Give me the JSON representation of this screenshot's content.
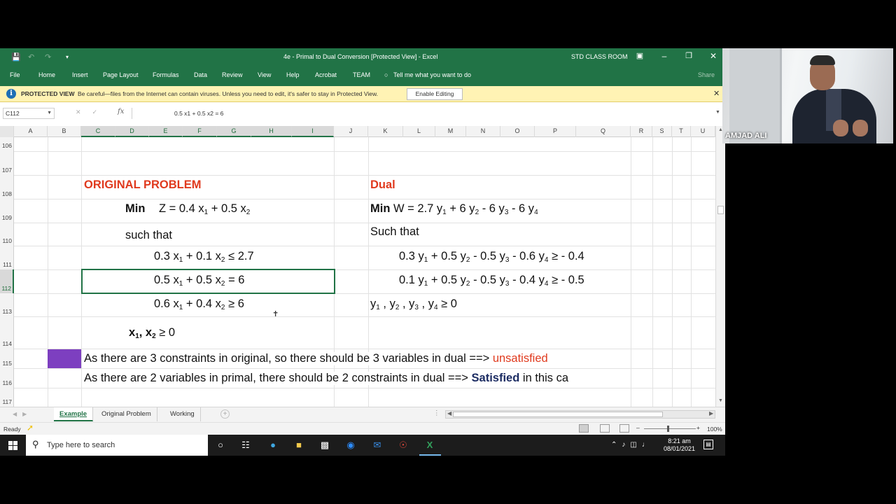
{
  "window": {
    "title": "4e - Primal to Dual Conversion  [Protected View]  -  Excel",
    "account": "STD CLASS ROOM",
    "quick_access": [
      "save-icon",
      "undo-icon",
      "redo-icon",
      "customize-icon"
    ],
    "window_buttons": [
      "ribbon-display-icon",
      "minimize-icon",
      "restore-icon",
      "close-icon"
    ]
  },
  "ribbon": {
    "tabs": [
      "File",
      "Home",
      "Insert",
      "Page Layout",
      "Formulas",
      "Data",
      "Review",
      "View",
      "Help",
      "Acrobat",
      "TEAM"
    ],
    "tell_me": "Tell me what you want to do",
    "share": "Share"
  },
  "protected_view": {
    "title": "PROTECTED VIEW",
    "message": "Be careful—files from the Internet can contain viruses. Unless you need to edit, it's safer to stay in Protected View.",
    "button": "Enable Editing"
  },
  "formula_bar": {
    "name_box": "C112",
    "formula": "0.5 x1 + 0.5 x2 = 6"
  },
  "columns": [
    "A",
    "B",
    "C",
    "D",
    "E",
    "F",
    "G",
    "H",
    "I",
    "J",
    "K",
    "L",
    "M",
    "N",
    "O",
    "P",
    "Q",
    "R",
    "S",
    "T",
    "U"
  ],
  "rows": [
    "106",
    "107",
    "108",
    "109",
    "110",
    "111",
    "112",
    "113",
    "114",
    "115",
    "116",
    "117"
  ],
  "selected_cell": {
    "column": "C",
    "row": "112"
  },
  "sheet": {
    "original_heading": "ORIGINAL PROBLEM",
    "primal_min_word": "Min",
    "primal_objective": {
      "lhs": "Z = 0.4 x",
      "s1": "1",
      "mid": " + 0.5 x",
      "s2": "2"
    },
    "primal_such_that": "such that",
    "primal_constraints": [
      {
        "a": "0.3 x",
        "s1": "1",
        "b": " + 0.1 x",
        "s2": "2",
        "c": " ≤ 2.7"
      },
      {
        "a": "0.5 x",
        "s1": "1",
        "b": " + 0.5 x",
        "s2": "2",
        "c": " = 6"
      },
      {
        "a": "0.6 x",
        "s1": "1",
        "b": " + 0.4 x",
        "s2": "2",
        "c": " ≥ 6"
      }
    ],
    "primal_nonneg": {
      "a": "x",
      "s1": "1",
      "b": ", x",
      "s2": "2",
      "c": " ≥ 0"
    },
    "dual_heading": "Dual",
    "dual_min_word": "Min",
    "dual_objective": {
      "a": "W = 2.7 y",
      "s1": "1",
      "b": " + 6 y",
      "s2": "2",
      "c": " - 6 y",
      "s3": "3",
      "d": " - 6 y",
      "s4": "4"
    },
    "dual_such_that": "Such that",
    "dual_constraints": [
      {
        "a": "0.3 y",
        "s1": "1",
        "b": " + 0.5 y",
        "s2": "2",
        "c": "  - 0.5 y",
        "s3": "3",
        "d": " - 0.6 y",
        "s4": "4",
        "e": " ≥ - 0.4"
      },
      {
        "a": "0.1 y",
        "s1": "1",
        "b": " + 0.5 y",
        "s2": "2",
        "c": "  - 0.5 y",
        "s3": "3",
        "d": " - 0.4 y",
        "s4": "4",
        "e": " ≥ - 0.5"
      }
    ],
    "dual_nonneg": {
      "a": "y",
      "s1": "1",
      "b": " , y",
      "s2": "2",
      "c": " , y",
      "s3": "3",
      "d": " , y",
      "s4": "4",
      "e": " ≥ 0"
    },
    "note1": {
      "text": "As there are 3 constraints in original, so there should be 3 variables in dual    ==> ",
      "status": "unsatisfied"
    },
    "note2": {
      "text": "As there are 2 variables in primal, there should be 2 constraints in dual   ==> ",
      "status": "Satisfied",
      "tail": " in this ca"
    },
    "highlight_color": "#7d3fc0"
  },
  "sheet_tabs": [
    "Example",
    "Original Problem",
    "Working"
  ],
  "active_sheet": "Example",
  "status_bar": {
    "ready": "Ready",
    "zoom": "100%"
  },
  "webcam": {
    "name": "AMJAD ALI"
  },
  "taskbar": {
    "search_placeholder": "Type here to search",
    "apps": [
      "cortana-icon",
      "task-view-icon",
      "edge-icon",
      "file-explorer-icon",
      "store-icon",
      "zoom-icon",
      "mail-icon",
      "chrome-icon",
      "excel-icon"
    ],
    "time": "8:21 am",
    "date": "08/01/2021"
  },
  "colors": {
    "excel_green": "#217346",
    "heading_red": "#e03a1e",
    "satisfied_navy": "#1d2d63",
    "protected_bar": "#fff3b4"
  }
}
